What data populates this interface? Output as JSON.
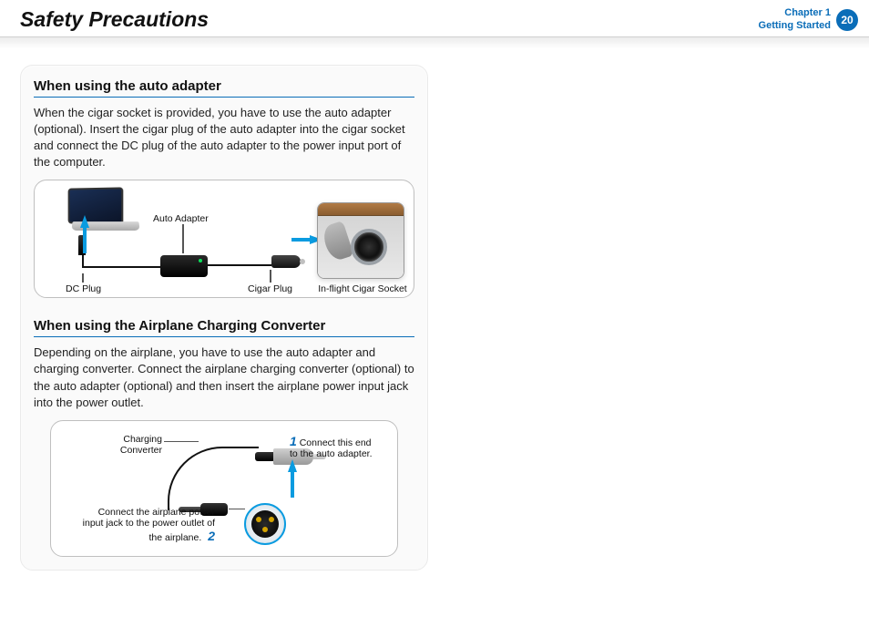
{
  "header": {
    "title": "Safety Precautions",
    "chapter_line1": "Chapter 1",
    "chapter_line2": "Getting Started",
    "page_number": "20"
  },
  "section1": {
    "heading": "When using the auto adapter",
    "body": "When the cigar socket is provided, you have to use the auto adapter (optional). Insert the cigar plug of the auto adapter into the cigar socket and connect the DC plug of the auto adapter to the power input port of the computer.",
    "labels": {
      "dc_plug": "DC Plug",
      "auto_adapter": "Auto Adapter",
      "cigar_plug": "Cigar Plug",
      "socket": "In-flight Cigar Socket"
    }
  },
  "section2": {
    "heading": "When using the Airplane Charging Converter",
    "body": "Depending on the airplane, you have to use the auto adapter and charging converter. Connect the airplane charging converter (optional) to the auto adapter (optional) and then insert the airplane power input jack into the power outlet.",
    "labels": {
      "converter": "Charging Converter",
      "step1_num": "1",
      "step1_text": "Connect this end to the auto adapter.",
      "step2_num": "2",
      "step2_text": "Connect the airplane power input jack to the power outlet of the airplane."
    }
  }
}
